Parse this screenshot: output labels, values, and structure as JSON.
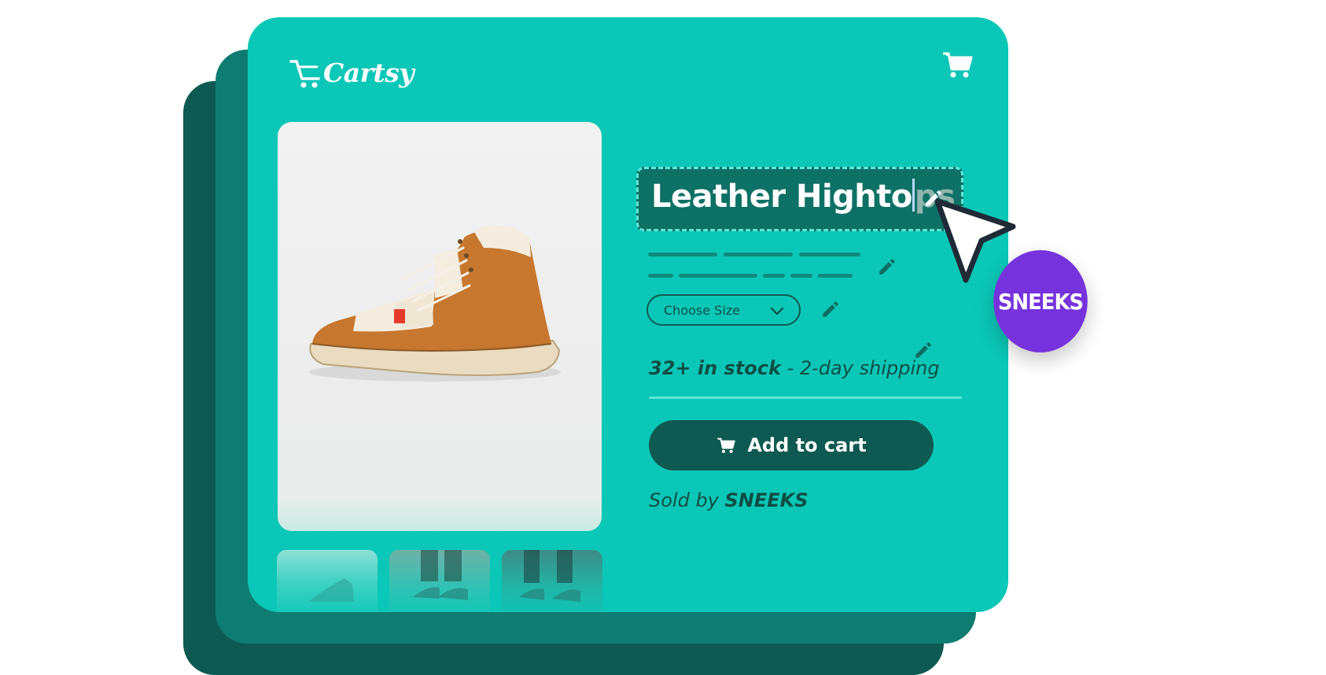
{
  "brand": {
    "name": "Cartsy",
    "accent": "#0bc7b7",
    "dark": "#0e5a52"
  },
  "header": {
    "cart_icon": "shopping-cart-icon"
  },
  "product": {
    "title_typed": "Leather Highto",
    "title_rest": "ps",
    "size_select": {
      "placeholder": "Choose Size"
    },
    "stock_bold": "32+ in stock",
    "stock_rest": " - 2-day shipping",
    "add_to_cart": "Add to cart",
    "sold_by_prefix": "Sold by ",
    "seller": "SNEEKS"
  },
  "badge": {
    "label": "SNEEKS",
    "color": "#7633dd"
  },
  "icons": [
    "cartsy-logo-icon",
    "shopping-cart-icon",
    "pencil-icon",
    "chevron-down-icon",
    "mouse-pointer-icon"
  ]
}
